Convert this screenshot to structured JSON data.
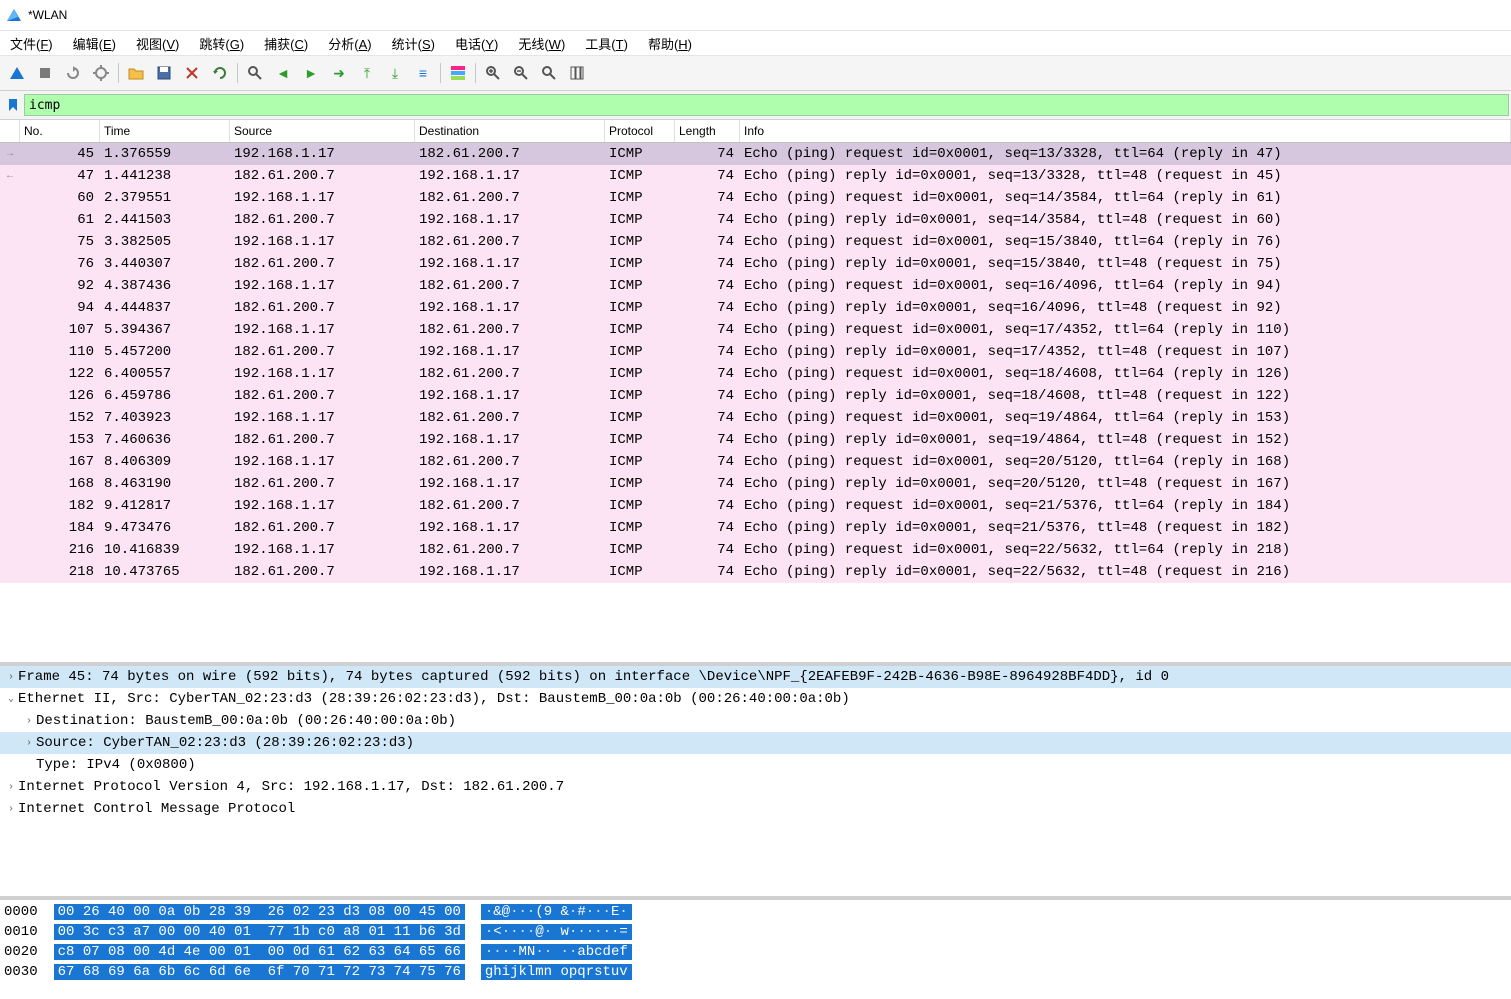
{
  "window": {
    "title": "*WLAN"
  },
  "menu": {
    "items": [
      {
        "label": "文件(F)"
      },
      {
        "label": "编辑(E)"
      },
      {
        "label": "视图(V)"
      },
      {
        "label": "跳转(G)"
      },
      {
        "label": "捕获(C)"
      },
      {
        "label": "分析(A)"
      },
      {
        "label": "统计(S)"
      },
      {
        "label": "电话(Y)"
      },
      {
        "label": "无线(W)"
      },
      {
        "label": "工具(T)"
      },
      {
        "label": "帮助(H)"
      }
    ]
  },
  "filter": {
    "value": "icmp"
  },
  "columns": {
    "no": "No.",
    "time": "Time",
    "source": "Source",
    "destination": "Destination",
    "protocol": "Protocol",
    "length": "Length",
    "info": "Info"
  },
  "packets": [
    {
      "selected": true,
      "gutter": "→",
      "no": "45",
      "time": "1.376559",
      "src": "192.168.1.17",
      "dst": "182.61.200.7",
      "proto": "ICMP",
      "len": "74",
      "info": "Echo (ping) request  id=0x0001, seq=13/3328, ttl=64 (reply in 47)"
    },
    {
      "gutter": "←",
      "no": "47",
      "time": "1.441238",
      "src": "182.61.200.7",
      "dst": "192.168.1.17",
      "proto": "ICMP",
      "len": "74",
      "info": "Echo (ping) reply    id=0x0001, seq=13/3328, ttl=48 (request in 45)"
    },
    {
      "no": "60",
      "time": "2.379551",
      "src": "192.168.1.17",
      "dst": "182.61.200.7",
      "proto": "ICMP",
      "len": "74",
      "info": "Echo (ping) request  id=0x0001, seq=14/3584, ttl=64 (reply in 61)"
    },
    {
      "no": "61",
      "time": "2.441503",
      "src": "182.61.200.7",
      "dst": "192.168.1.17",
      "proto": "ICMP",
      "len": "74",
      "info": "Echo (ping) reply    id=0x0001, seq=14/3584, ttl=48 (request in 60)"
    },
    {
      "no": "75",
      "time": "3.382505",
      "src": "192.168.1.17",
      "dst": "182.61.200.7",
      "proto": "ICMP",
      "len": "74",
      "info": "Echo (ping) request  id=0x0001, seq=15/3840, ttl=64 (reply in 76)"
    },
    {
      "no": "76",
      "time": "3.440307",
      "src": "182.61.200.7",
      "dst": "192.168.1.17",
      "proto": "ICMP",
      "len": "74",
      "info": "Echo (ping) reply    id=0x0001, seq=15/3840, ttl=48 (request in 75)"
    },
    {
      "no": "92",
      "time": "4.387436",
      "src": "192.168.1.17",
      "dst": "182.61.200.7",
      "proto": "ICMP",
      "len": "74",
      "info": "Echo (ping) request  id=0x0001, seq=16/4096, ttl=64 (reply in 94)"
    },
    {
      "no": "94",
      "time": "4.444837",
      "src": "182.61.200.7",
      "dst": "192.168.1.17",
      "proto": "ICMP",
      "len": "74",
      "info": "Echo (ping) reply    id=0x0001, seq=16/4096, ttl=48 (request in 92)"
    },
    {
      "no": "107",
      "time": "5.394367",
      "src": "192.168.1.17",
      "dst": "182.61.200.7",
      "proto": "ICMP",
      "len": "74",
      "info": "Echo (ping) request  id=0x0001, seq=17/4352, ttl=64 (reply in 110)"
    },
    {
      "no": "110",
      "time": "5.457200",
      "src": "182.61.200.7",
      "dst": "192.168.1.17",
      "proto": "ICMP",
      "len": "74",
      "info": "Echo (ping) reply    id=0x0001, seq=17/4352, ttl=48 (request in 107)"
    },
    {
      "no": "122",
      "time": "6.400557",
      "src": "192.168.1.17",
      "dst": "182.61.200.7",
      "proto": "ICMP",
      "len": "74",
      "info": "Echo (ping) request  id=0x0001, seq=18/4608, ttl=64 (reply in 126)"
    },
    {
      "no": "126",
      "time": "6.459786",
      "src": "182.61.200.7",
      "dst": "192.168.1.17",
      "proto": "ICMP",
      "len": "74",
      "info": "Echo (ping) reply    id=0x0001, seq=18/4608, ttl=48 (request in 122)"
    },
    {
      "no": "152",
      "time": "7.403923",
      "src": "192.168.1.17",
      "dst": "182.61.200.7",
      "proto": "ICMP",
      "len": "74",
      "info": "Echo (ping) request  id=0x0001, seq=19/4864, ttl=64 (reply in 153)"
    },
    {
      "no": "153",
      "time": "7.460636",
      "src": "182.61.200.7",
      "dst": "192.168.1.17",
      "proto": "ICMP",
      "len": "74",
      "info": "Echo (ping) reply    id=0x0001, seq=19/4864, ttl=48 (request in 152)"
    },
    {
      "no": "167",
      "time": "8.406309",
      "src": "192.168.1.17",
      "dst": "182.61.200.7",
      "proto": "ICMP",
      "len": "74",
      "info": "Echo (ping) request  id=0x0001, seq=20/5120, ttl=64 (reply in 168)"
    },
    {
      "no": "168",
      "time": "8.463190",
      "src": "182.61.200.7",
      "dst": "192.168.1.17",
      "proto": "ICMP",
      "len": "74",
      "info": "Echo (ping) reply    id=0x0001, seq=20/5120, ttl=48 (request in 167)"
    },
    {
      "no": "182",
      "time": "9.412817",
      "src": "192.168.1.17",
      "dst": "182.61.200.7",
      "proto": "ICMP",
      "len": "74",
      "info": "Echo (ping) request  id=0x0001, seq=21/5376, ttl=64 (reply in 184)"
    },
    {
      "no": "184",
      "time": "9.473476",
      "src": "182.61.200.7",
      "dst": "192.168.1.17",
      "proto": "ICMP",
      "len": "74",
      "info": "Echo (ping) reply    id=0x0001, seq=21/5376, ttl=48 (request in 182)"
    },
    {
      "no": "216",
      "time": "10.416839",
      "src": "192.168.1.17",
      "dst": "182.61.200.7",
      "proto": "ICMP",
      "len": "74",
      "info": "Echo (ping) request  id=0x0001, seq=22/5632, ttl=64 (reply in 218)"
    },
    {
      "no": "218",
      "time": "10.473765",
      "src": "182.61.200.7",
      "dst": "192.168.1.17",
      "proto": "ICMP",
      "len": "74",
      "info": "Echo (ping) reply    id=0x0001, seq=22/5632, ttl=48 (request in 216)"
    }
  ],
  "details": [
    {
      "level": 0,
      "toggle": ">",
      "selected": true,
      "text": "Frame 45: 74 bytes on wire (592 bits), 74 bytes captured (592 bits) on interface \\Device\\NPF_{2EAFEB9F-242B-4636-B98E-8964928BF4DD}, id 0"
    },
    {
      "level": 0,
      "toggle": "v",
      "text": "Ethernet II, Src: CyberTAN_02:23:d3 (28:39:26:02:23:d3), Dst: BaustemB_00:0a:0b (00:26:40:00:0a:0b)"
    },
    {
      "level": 1,
      "toggle": ">",
      "text": "Destination: BaustemB_00:0a:0b (00:26:40:00:0a:0b)"
    },
    {
      "level": 1,
      "toggle": ">",
      "selected": true,
      "text": "Source: CyberTAN_02:23:d3 (28:39:26:02:23:d3)"
    },
    {
      "level": 1,
      "toggle": "",
      "text": "Type: IPv4 (0x0800)"
    },
    {
      "level": 0,
      "toggle": ">",
      "text": "Internet Protocol Version 4, Src: 192.168.1.17, Dst: 182.61.200.7"
    },
    {
      "level": 0,
      "toggle": ">",
      "text": "Internet Control Message Protocol"
    }
  ],
  "hex": [
    {
      "offset": "0000",
      "bytes": "00 26 40 00 0a 0b 28 39  26 02 23 d3 08 00 45 00",
      "ascii": "·&@···(9 &·#···E·"
    },
    {
      "offset": "0010",
      "bytes": "00 3c c3 a7 00 00 40 01  77 1b c0 a8 01 11 b6 3d",
      "ascii": "·<····@· w······="
    },
    {
      "offset": "0020",
      "bytes": "c8 07 08 00 4d 4e 00 01  00 0d 61 62 63 64 65 66",
      "ascii": "····MN·· ··abcdef"
    },
    {
      "offset": "0030",
      "bytes": "67 68 69 6a 6b 6c 6d 6e  6f 70 71 72 73 74 75 76",
      "ascii": "ghijklmn opqrstuv"
    }
  ]
}
